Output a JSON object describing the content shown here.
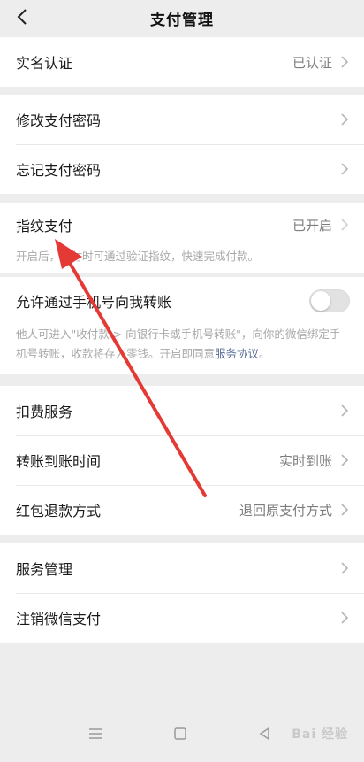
{
  "header": {
    "title": "支付管理"
  },
  "groups": {
    "realname": {
      "label": "实名认证",
      "value": "已认证"
    },
    "password": {
      "change": {
        "label": "修改支付密码"
      },
      "forgot": {
        "label": "忘记支付密码"
      }
    },
    "fingerprint": {
      "label": "指纹支付",
      "value": "已开启",
      "desc": "开启后，支付时可通过验证指纹，快速完成付款。"
    },
    "phone_transfer": {
      "label": "允许通过手机号向我转账",
      "toggle_on": false,
      "desc": "他人可进入\"收付款 > 向银行卡或手机号转账\"，向你的微信绑定手机号转账，收款将存入零钱。开启即同意",
      "link": "服务协议",
      "desc_end": "。"
    },
    "services": {
      "deduction": {
        "label": "扣费服务"
      },
      "arrival_time": {
        "label": "转账到账时间",
        "value": "实时到账"
      },
      "refund": {
        "label": "红包退款方式",
        "value": "退回原支付方式"
      }
    },
    "manage": {
      "service_manage": {
        "label": "服务管理"
      },
      "cancel_pay": {
        "label": "注销微信支付"
      }
    }
  },
  "watermark": "Bai 经验",
  "colors": {
    "background": "#ededed",
    "link": "#576b95",
    "arrow": "#e53935"
  },
  "icons": {
    "back": "chevron-left-icon",
    "row": "chevron-right-icon",
    "nav": [
      "menu-icon",
      "home-square-icon",
      "back-triangle-icon"
    ]
  }
}
